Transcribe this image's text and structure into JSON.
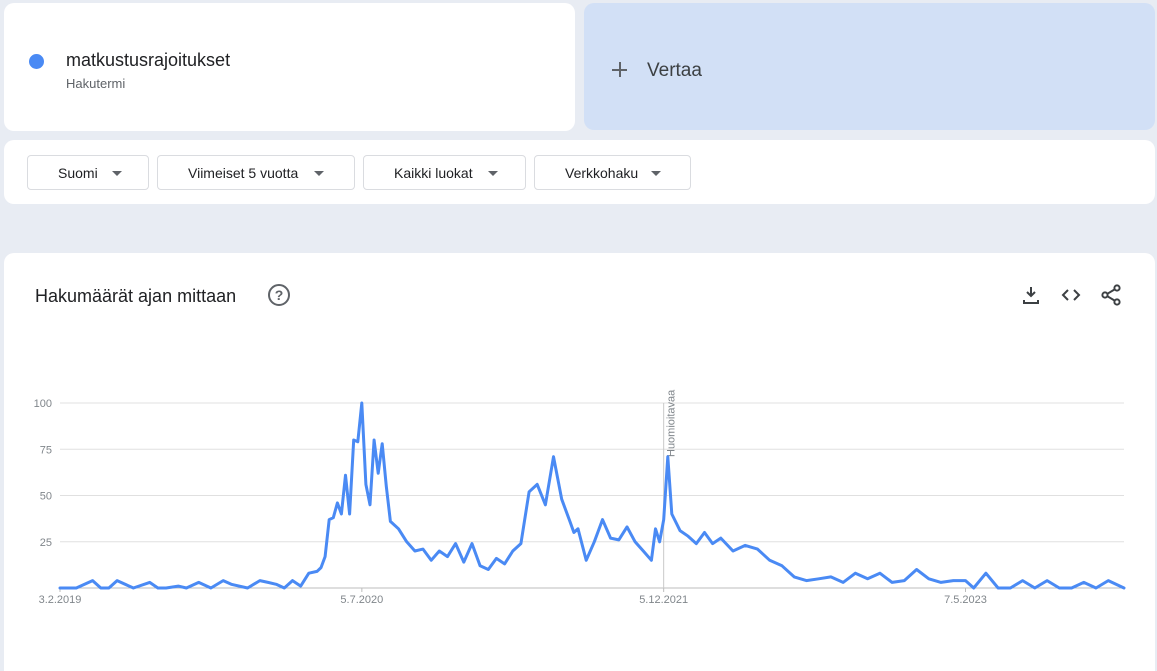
{
  "term": {
    "name": "matkustusrajoitukset",
    "type": "Hakutermi",
    "color": "#4a8af4"
  },
  "compare": {
    "label": "Vertaa",
    "icon": "plus-icon"
  },
  "filters": [
    {
      "label": "Suomi"
    },
    {
      "label": "Viimeiset 5 vuotta"
    },
    {
      "label": "Kaikki luokat"
    },
    {
      "label": "Verkkohaku"
    }
  ],
  "chart_header": {
    "title": "Hakumäärät ajan mittaan",
    "help_icon": "help-circle-icon",
    "tools": [
      "download-icon",
      "embed-code-icon",
      "share-icon"
    ]
  },
  "chart_data": {
    "type": "line",
    "title": "Hakumäärät ajan mittaan",
    "xlabel": "",
    "ylabel": "",
    "ylim": [
      0,
      100
    ],
    "yticks": [
      100,
      75,
      50,
      25
    ],
    "grid": true,
    "x_range": [
      "2019-02-03",
      "2024-02-03"
    ],
    "xtick_labels": [
      {
        "label": "3.2.2019",
        "date": "2019-02-03"
      },
      {
        "label": "5.7.2020",
        "date": "2020-07-05"
      },
      {
        "label": "5.12.2021",
        "date": "2021-12-05"
      },
      {
        "label": "7.5.2023",
        "date": "2023-05-07"
      }
    ],
    "annotation": {
      "label": "Huomioitavaa",
      "date": "2021-12-05"
    },
    "series": [
      {
        "color": "#4a8af4",
        "x": [
          "2019-02-03",
          "2019-03-03",
          "2019-03-31",
          "2019-04-14",
          "2019-04-28",
          "2019-05-12",
          "2019-06-09",
          "2019-07-07",
          "2019-07-21",
          "2019-08-04",
          "2019-08-25",
          "2019-09-08",
          "2019-09-29",
          "2019-10-20",
          "2019-11-10",
          "2019-11-24",
          "2019-12-22",
          "2020-01-12",
          "2020-01-26",
          "2020-02-09",
          "2020-02-23",
          "2020-03-08",
          "2020-03-22",
          "2020-04-05",
          "2020-04-19",
          "2020-04-26",
          "2020-05-03",
          "2020-05-10",
          "2020-05-17",
          "2020-05-24",
          "2020-05-31",
          "2020-06-07",
          "2020-06-14",
          "2020-06-21",
          "2020-06-28",
          "2020-07-05",
          "2020-07-12",
          "2020-07-19",
          "2020-07-26",
          "2020-08-02",
          "2020-08-09",
          "2020-08-16",
          "2020-08-23",
          "2020-09-06",
          "2020-09-20",
          "2020-10-04",
          "2020-10-18",
          "2020-11-01",
          "2020-11-15",
          "2020-11-29",
          "2020-12-13",
          "2020-12-27",
          "2021-01-10",
          "2021-01-24",
          "2021-02-07",
          "2021-02-21",
          "2021-03-07",
          "2021-03-21",
          "2021-04-04",
          "2021-04-18",
          "2021-05-02",
          "2021-05-16",
          "2021-05-30",
          "2021-06-13",
          "2021-06-27",
          "2021-07-04",
          "2021-07-11",
          "2021-07-25",
          "2021-08-08",
          "2021-08-22",
          "2021-09-05",
          "2021-09-19",
          "2021-10-03",
          "2021-10-17",
          "2021-10-31",
          "2021-11-14",
          "2021-11-21",
          "2021-11-28",
          "2021-12-05",
          "2021-12-12",
          "2021-12-19",
          "2022-01-02",
          "2022-01-16",
          "2022-01-30",
          "2022-02-13",
          "2022-02-27",
          "2022-03-13",
          "2022-04-03",
          "2022-04-24",
          "2022-05-15",
          "2022-06-05",
          "2022-06-26",
          "2022-07-17",
          "2022-08-07",
          "2022-08-28",
          "2022-09-18",
          "2022-10-09",
          "2022-10-30",
          "2022-11-20",
          "2022-12-11",
          "2023-01-01",
          "2023-01-22",
          "2023-02-12",
          "2023-03-05",
          "2023-03-26",
          "2023-04-16",
          "2023-05-07",
          "2023-05-21",
          "2023-06-11",
          "2023-07-02",
          "2023-07-23",
          "2023-08-13",
          "2023-09-03",
          "2023-09-24",
          "2023-10-15",
          "2023-11-05",
          "2023-11-26",
          "2023-12-17",
          "2024-01-07",
          "2024-02-03"
        ],
        "values": [
          0,
          0,
          4,
          0,
          0,
          4,
          0,
          3,
          0,
          0,
          1,
          0,
          3,
          0,
          4,
          2,
          0,
          4,
          3,
          2,
          0,
          4,
          1,
          8,
          9,
          11,
          17,
          37,
          38,
          46,
          40,
          61,
          40,
          80,
          79,
          100,
          56,
          45,
          80,
          62,
          78,
          55,
          36,
          32,
          25,
          20,
          21,
          15,
          20,
          17,
          24,
          14,
          24,
          12,
          10,
          16,
          13,
          20,
          24,
          52,
          56,
          45,
          71,
          48,
          36,
          30,
          32,
          15,
          25,
          37,
          27,
          26,
          33,
          25,
          20,
          15,
          32,
          25,
          37,
          71,
          40,
          31,
          28,
          24,
          30,
          24,
          27,
          20,
          23,
          21,
          15,
          12,
          6,
          4,
          5,
          6,
          3,
          8,
          5,
          8,
          3,
          4,
          10,
          5,
          3,
          4,
          4,
          0,
          8,
          0,
          0,
          4,
          0,
          4,
          0,
          0,
          3,
          0,
          4,
          0
        ]
      }
    ]
  }
}
